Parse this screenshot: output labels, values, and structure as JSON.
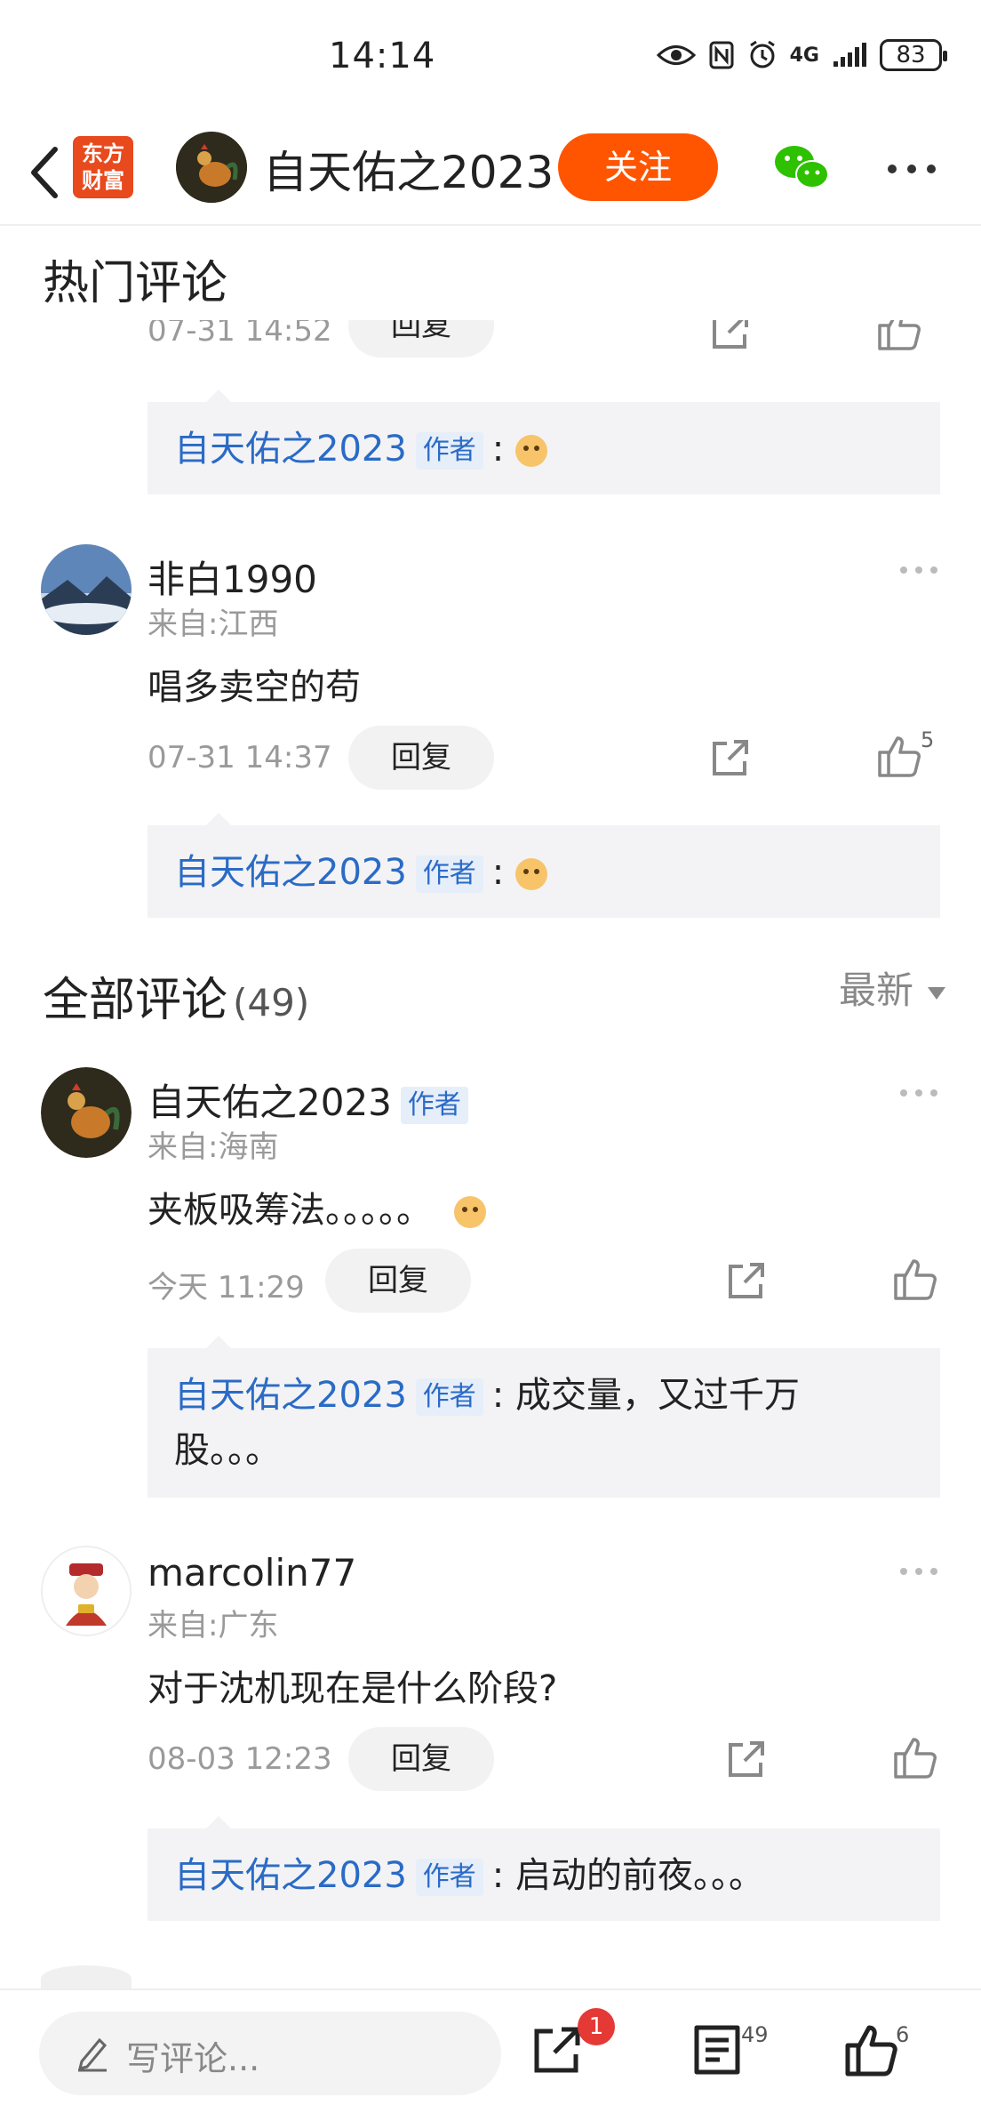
{
  "status_bar": {
    "time": "14:14",
    "battery": "83",
    "network": "4G"
  },
  "header": {
    "logo_text": "东方财富",
    "author_name": "自天佑之2023",
    "follow_label": "关注"
  },
  "hot_comments": {
    "title": "热门评论",
    "partial_item": {
      "time": "07-31 14:52",
      "reply_label": "回复"
    },
    "partial_reply": {
      "name": "自天佑之2023",
      "badge": "作者",
      "sep": ":"
    },
    "items": [
      {
        "user": "非白1990",
        "location": "来自:江西",
        "text": "唱多卖空的苟",
        "time": "07-31 14:37",
        "reply_label": "回复",
        "likes": "5",
        "reply": {
          "name": "自天佑之2023",
          "badge": "作者",
          "sep": ":"
        }
      }
    ]
  },
  "all_comments": {
    "title": "全部评论",
    "count": "(49)",
    "sort_label": "最新",
    "items": [
      {
        "user": "自天佑之2023",
        "badge": "作者",
        "location": "来自:海南",
        "text": "夹板吸筹法。。。。。",
        "time": "今天 11:29",
        "reply_label": "回复",
        "reply": {
          "name": "自天佑之2023",
          "badge": "作者",
          "sep": ":",
          "text": "成交量，又过千万",
          "text2": "股。。。"
        }
      },
      {
        "user": "marcolin77",
        "location": "来自:广东",
        "text": "对于沈机现在是什么阶段?",
        "time": "08-03 12:23",
        "reply_label": "回复",
        "reply": {
          "name": "自天佑之2023",
          "badge": "作者",
          "sep": ":",
          "text": "启动的前夜。。。"
        }
      }
    ]
  },
  "bottom_bar": {
    "input_placeholder": "写评论...",
    "share_badge": "1",
    "comment_count": "49",
    "like_count": "6"
  },
  "colors": {
    "accent": "#ff5500",
    "link_blue": "#2a6bc6",
    "badge_bg": "#e6eef9",
    "reply_bg": "#f3f3f5"
  }
}
